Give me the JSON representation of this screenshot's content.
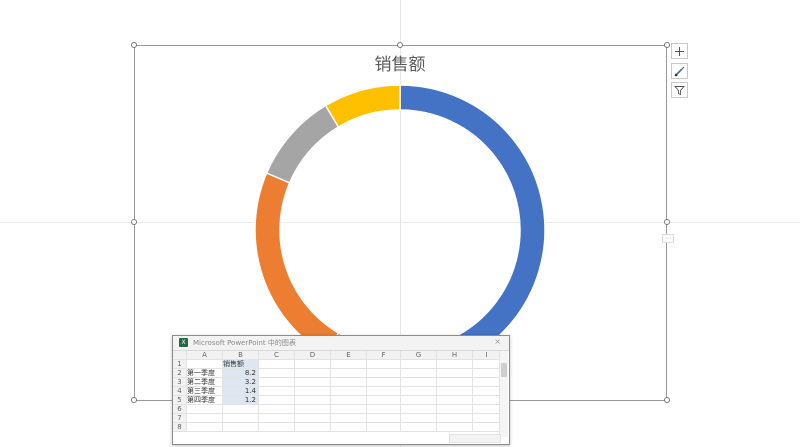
{
  "chart_data": {
    "type": "pie",
    "title": "销售额",
    "categories": [
      "第一季度",
      "第二季度",
      "第三季度",
      "第四季度"
    ],
    "values": [
      8.2,
      3.2,
      1.4,
      1.2
    ],
    "colors": [
      "#4472C4",
      "#ED7D31",
      "#A5A5A5",
      "#FFC000"
    ],
    "legend": "none"
  },
  "side_tools": {
    "add": "plus-icon",
    "style": "brush-icon",
    "filter": "filter-icon"
  },
  "spreadsheet": {
    "title": "Microsoft PowerPoint 中的图表",
    "close": "×",
    "columns": [
      "A",
      "B",
      "C",
      "D",
      "E",
      "F",
      "G",
      "H",
      "I"
    ],
    "rows": [
      "1",
      "2",
      "3",
      "4",
      "5",
      "6",
      "7",
      "8"
    ],
    "header_b1": "销售额",
    "labels": [
      "第一季度",
      "第二季度",
      "第三季度",
      "第四季度"
    ],
    "values": [
      "8.2",
      "3.2",
      "1.4",
      "1.2"
    ]
  }
}
